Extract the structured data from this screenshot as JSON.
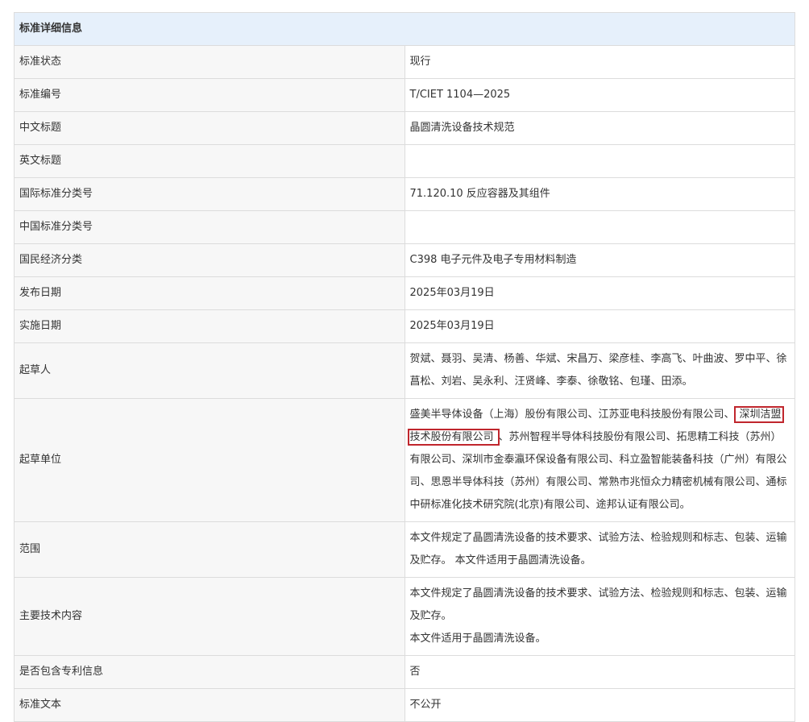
{
  "header": {
    "title": "标准详细信息"
  },
  "rows": [
    {
      "label": "标准状态",
      "value": "现行"
    },
    {
      "label": "标准编号",
      "value": "T/CIET 1104—2025"
    },
    {
      "label": "中文标题",
      "value": "晶圆清洗设备技术规范"
    },
    {
      "label": "英文标题",
      "value": ""
    },
    {
      "label": "国际标准分类号",
      "value": "71.120.10 反应容器及其组件"
    },
    {
      "label": "中国标准分类号",
      "value": ""
    },
    {
      "label": "国民经济分类",
      "value": "C398 电子元件及电子专用材料制造"
    },
    {
      "label": "发布日期",
      "value": "2025年03月19日"
    },
    {
      "label": "实施日期",
      "value": "2025年03月19日"
    },
    {
      "label": "起草人",
      "value": "贺斌、聂羽、吴清、杨善、华斌、宋昌万、梁彦桂、李高飞、叶曲波、罗中平、徐菖松、刘岩、吴永利、汪贤峰、李泰、徐敬铭、包瑾、田添。"
    },
    {
      "label": "起草单位",
      "value_before": "盛美半导体设备（上海）股份有限公司、江苏亚电科技股份有限公司、",
      "value_highlight": "深圳洁盟技术股份有限公司",
      "value_after": "、苏州智程半导体科技股份有限公司、拓思精工科技（苏州）有限公司、深圳市金泰瀛环保设备有限公司、科立盈智能装备科技（广州）有限公司、思恩半导体科技（苏州）有限公司、常熟市兆恒众力精密机械有限公司、通标中研标准化技术研究院(北京)有限公司、途邦认证有限公司。"
    },
    {
      "label": "范围",
      "value": "本文件规定了晶圆清洗设备的技术要求、试验方法、检验规则和标志、包装、运输及贮存。 本文件适用于晶圆清洗设备。"
    },
    {
      "label": "主要技术内容",
      "line1": "本文件规定了晶圆清洗设备的技术要求、试验方法、检验规则和标志、包装、运输及贮存。",
      "line2": "本文件适用于晶圆清洗设备。"
    },
    {
      "label": "是否包含专利信息",
      "value": "否"
    },
    {
      "label": "标准文本",
      "value": "不公开"
    }
  ],
  "colors": {
    "header_bg": "#e6f0fb",
    "label_bg": "#f7f7f7",
    "border": "#dcdcdc",
    "highlight": "#c0262d"
  }
}
